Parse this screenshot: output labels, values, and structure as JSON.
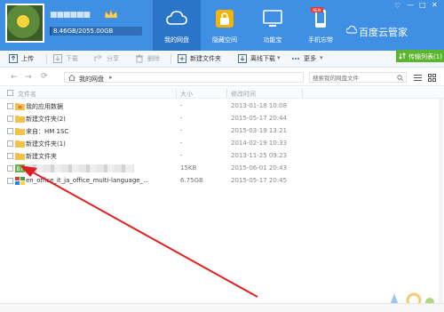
{
  "header": {
    "username": "■■■■■■",
    "quota_text": "8.46GB/2055.00GB",
    "quota_fraction": 0.004,
    "tabs": [
      {
        "label": "我的网盘",
        "icon": "cloud-icon",
        "active": true
      },
      {
        "label": "隐藏空间",
        "icon": "lock-icon",
        "active": false
      },
      {
        "label": "功能宝",
        "icon": "monitor-icon",
        "active": false
      },
      {
        "label": "手机忘带",
        "icon": "phone-icon",
        "active": false,
        "badge": "NEW"
      }
    ],
    "brand": "百度云管家",
    "window_controls": [
      "♡",
      "—",
      "□",
      "✕"
    ]
  },
  "toolbar": {
    "upload": "上传",
    "download": "下载",
    "share": "分享",
    "delete": "删除",
    "new_folder": "新建文件夹",
    "offline_download": "离线下载",
    "more": "更多",
    "transfer_list": "传输列表(1)"
  },
  "address": {
    "back": "←",
    "forward": "→",
    "path": "我的网盘",
    "search_placeholder": "搜索我的网盘文件"
  },
  "list": {
    "columns": [
      "文件名",
      "大小",
      "修改时间"
    ],
    "rows": [
      {
        "name": "我的应用数据",
        "size": "-",
        "date": "2013-01-18 10:08",
        "icon": "app-folder-icon"
      },
      {
        "name": "新建文件夹(2)",
        "size": "-",
        "date": "2015-05-17 20:44",
        "icon": "folder-icon"
      },
      {
        "name": "来自：HM 1SC",
        "size": "-",
        "date": "2015-03-19 13:21",
        "icon": "folder-icon"
      },
      {
        "name": "新建文件夹(1)",
        "size": "-",
        "date": "2014-02-19 10:33",
        "icon": "folder-icon"
      },
      {
        "name": "新建文件夹",
        "size": "-",
        "date": "2013-11-25 09:23",
        "icon": "folder-icon"
      },
      {
        "name": "",
        "size": "15KB",
        "date": "2015-06-01 20:43",
        "icon": "bt-file-icon",
        "blurred": true
      },
      {
        "name": "en_office_it_ja_office_multi-language_...",
        "size": "6.75GB",
        "date": "2015-05-17 20:45",
        "icon": "installer-icon"
      }
    ]
  },
  "colors": {
    "header_bg": "#3f8fe4",
    "active_tab": "#2a75c8",
    "folder": "#f5c04a",
    "annotation_arrow": "#e02020",
    "transfer_green": "#5cb531"
  }
}
